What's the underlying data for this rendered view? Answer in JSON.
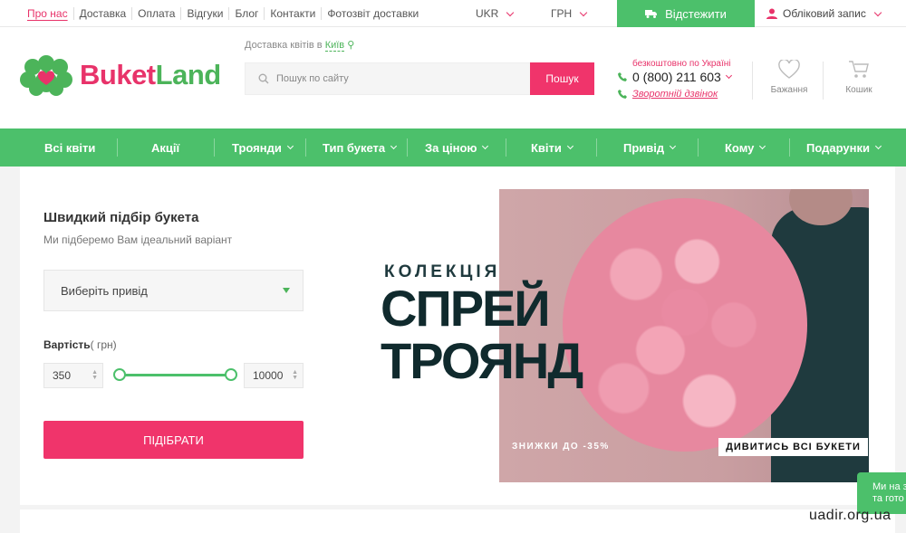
{
  "topbar": {
    "links": [
      "Про нас",
      "Доставка",
      "Оплата",
      "Відгуки",
      "Блог",
      "Контакти",
      "Фотозвіт доставки"
    ],
    "language": "UKR",
    "currency": "ГРН",
    "track_label": "Відстежити",
    "account_label": "Обліковий запис"
  },
  "header": {
    "logo_part1": "Buket",
    "logo_part2": "Land",
    "delivery_text": "Доставка квітів в",
    "city": "Київ",
    "search_placeholder": "Пошук по сайту",
    "search_button": "Пошук",
    "free_text": "безкоштовно по Україні",
    "phone": "0 (800) 211 603",
    "callback": "Зворотній дзвінок",
    "favorites_label": "Бажання",
    "cart_label": "Кошик"
  },
  "nav": {
    "items": [
      {
        "label": "Всі квіти"
      },
      {
        "label": "Акції"
      },
      {
        "label": "Троянди"
      },
      {
        "label": "Тип букета"
      },
      {
        "label": "За ціною"
      },
      {
        "label": "Квіти"
      },
      {
        "label": "Привід"
      },
      {
        "label": "Кому"
      },
      {
        "label": "Подарунки"
      }
    ]
  },
  "quick_select": {
    "title": "Швидкий підбір букета",
    "subtitle": "Ми підберемо Вам ідеальний варіант",
    "occasion_placeholder": "Виберіть привід",
    "price_label": "Вартість",
    "price_unit": "( грн)",
    "min_price": "350",
    "max_price": "10000",
    "button": "ПІДІБРАТИ"
  },
  "banner": {
    "collection": "КОЛЕКЦІЯ",
    "line1": "СПРЕЙ",
    "line2": "ТРОЯНД",
    "discount": "ЗНИЖКИ ДО -35%",
    "see_all": "ДИВИТИСЬ ВСІ БУКЕТИ"
  },
  "chat": {
    "line1": "Ми на з",
    "line2": "та гото"
  },
  "watermark": "uadir.org.ua",
  "colors": {
    "green": "#4cc06b",
    "pink": "#f0346b"
  }
}
